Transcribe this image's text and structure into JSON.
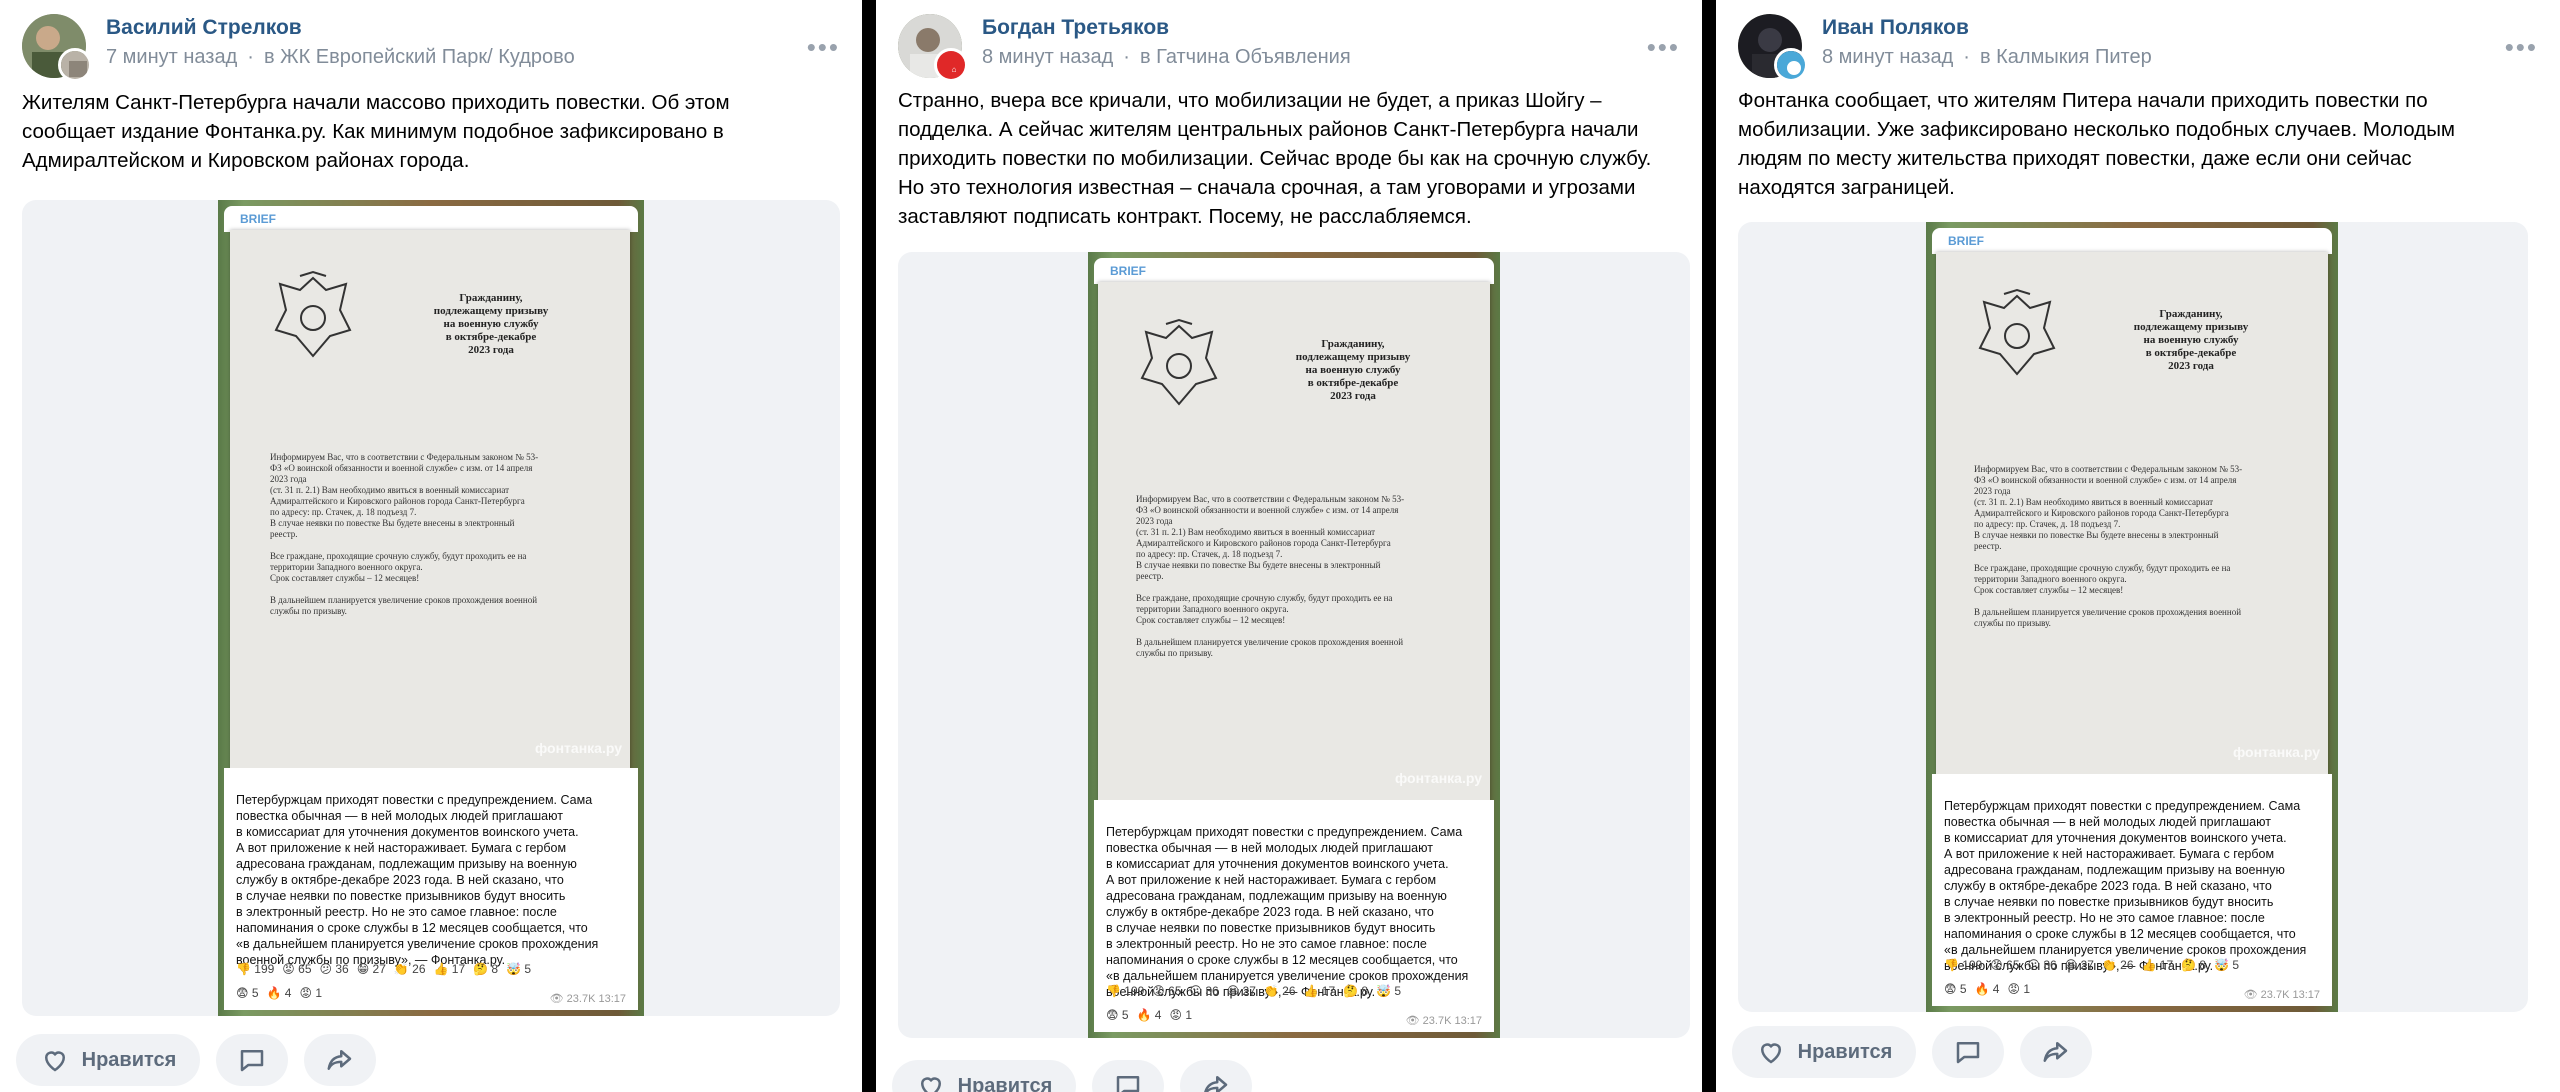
{
  "posts": [
    {
      "author": "Василий Стрелков",
      "time": "7 минут назад",
      "group": "в ЖК Европейский Парк/ Кудрово",
      "text": "Жителям Санкт-Петербурга начали массово приходить повестки. Об этом\nсообщает издание Фонтанка.ру. Как минимум подобное зафиксировано в\nАдмиралтейском и Кировском районах города.",
      "like_label": "Нравится"
    },
    {
      "author": "Богдан Третьяков",
      "time": "8 минут назад",
      "group": "в Гатчина Объявления",
      "text": "Странно, вчера все кричали, что мобилизации не будет, а приказ Шойгу –\nподделка. А сейчас жителям центральных районов Санкт-Петербурга начали\nприходить повестки по мобилизации. Сейчас вроде бы как на срочную службу.\nНо это технология известная – сначала срочная, а там уговорами и угрозами\nзаставляют подписать контракт. Посему, не расслабляемся.",
      "like_label": "Нравится"
    },
    {
      "author": "Иван Поляков",
      "time": "8 минут назад",
      "group": "в Калмыкия Питер",
      "text": "Фонтанка сообщает, что жителям Питера начали приходить повестки по\nмобилизации. Уже зафиксировано несколько подобных случаев. Молодым\nлюдям по месту жительства приходят повестки, даже если они сейчас\nнаходятся заграницей.",
      "like_label": "Нравится"
    }
  ],
  "screenshot": {
    "brief_label": "BRIEF",
    "doc_title": "Гражданину,\nподлежащему призыву\nна военную службу\nв октябре-декабре\n2023 года",
    "doc_body": "Информируем Вас, что в соответствии с Федеральным законом № 53-\nФЗ «О воинской обязанности и военной службе» с изм. от 14 апреля\n2023                                                                                   года\n(ст. 31 п. 2.1) Вам необходимо явиться в военный комиссариат\nАдмиралтейского и Кировского районов города Санкт-Петербурга\nпо адресу: пр. Стачек, д. 18 подъезд 7.\nВ случае неявки по повестке Вы будете внесены в электронный\nреестр.\n\nВсе граждане, проходящие срочную службу, будут проходить ее на\nтерритории Западного военного округа.\nСрок составляет службы – 12 месяцев!\n\nВ дальнейшем планируется увеличение сроков прохождения военной\nслужбы по призыву.",
    "watermark": "фонтанка.ру",
    "caption": "Петербуржцам приходят повестки с предупреждением. Сама\nповестка обычная — в ней молодых людей приглашают\nв комиссариат для уточнения документов воинского учета.\nА вот приложение к ней настораживает. Бумага с гербом\nадресована гражданам, подлежащим призыву на военную\nслужбу в октябре-декабре 2023 года. В ней сказано, что\nв случае неявки по повестке призывников будут вносить\nв электронный реестр. Но не это самое главное: после\nнапоминания о сроке службы в 12 месяцев сообщается, что\n«в дальнейшем планируется увеличение сроков прохождения\nвоенной службы по призыву», — Фонтанка.ру.",
    "reactions_row1": [
      "👎 199",
      "😡 65",
      "😕 36",
      "😁 27",
      "👏 26",
      "👍 17",
      "🤔 8",
      "🤯 5"
    ],
    "reactions_row2": [
      "😨 5",
      "🔥 4",
      "😡 1"
    ],
    "views": "👁 23.7K  13:17"
  }
}
